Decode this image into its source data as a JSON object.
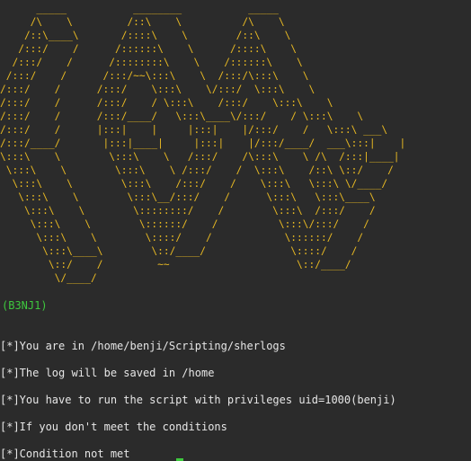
{
  "terminal": {
    "banner": "      _____           ________           _____\n     /\\    \\         /::\\    \\          /\\    \\\n    /::\\____\\       /::::\\    \\        /::\\    \\\n   /:::/    /      /::::::\\    \\      /::::\\    \\\n  /:::/    /      /::::::::\\    \\    /::::::\\    \\\n /:::/    /      /:::/~~\\:::\\    \\  /:::/\\:::\\    \\\n/:::/    /      /:::/    \\:::\\    \\/:::/  \\:::\\    \\\n/:::/    /      /:::/    / \\:::\\    /:::/    \\:::\\    \\\n/:::/    /      /:::/____/   \\:::\\____\\/:::/    / \\:::\\    \\\n/:::/    /      |:::|    |     |:::|    |/:::/    /   \\:::\\ ___\\\n/:::/____/       |:::|____|     |:::|    |/:::/____/  ___\\:::|    |\n\\:::\\    \\        \\:::\\    \\   /:::/    /\\:::\\    \\ /\\  /:::|____|\n \\:::\\    \\        \\:::\\    \\ /:::/    /  \\:::\\    /::\\ \\::/    /\n  \\:::\\    \\        \\:::\\    /:::/    /    \\:::\\   \\:::\\ \\/____/\n   \\:::\\    \\        \\:::\\__/:::/    /      \\:::\\   \\:::\\____\\\n    \\:::\\    \\        \\::::::::/    /        \\:::\\  /:::/    /\n     \\:::\\    \\        \\::::::/    /          \\:::\\/:::/    /\n      \\:::\\    \\        \\::::/    /            \\::::::/    /\n       \\:::\\____\\        \\::/____/              \\::::/    /\n        \\::/    /         ~~                     \\::/____/\n         \\/____/",
    "tag": "(B3NJ1)",
    "lines": [
      "[*]You are in /home/benji/Scripting/sherlogs",
      "[*]The log will be saved in /home",
      "[*]You have to run the script with privileges uid=1000(benji)",
      "[*]If you don't meet the conditions",
      "[*]Condition not met"
    ]
  }
}
